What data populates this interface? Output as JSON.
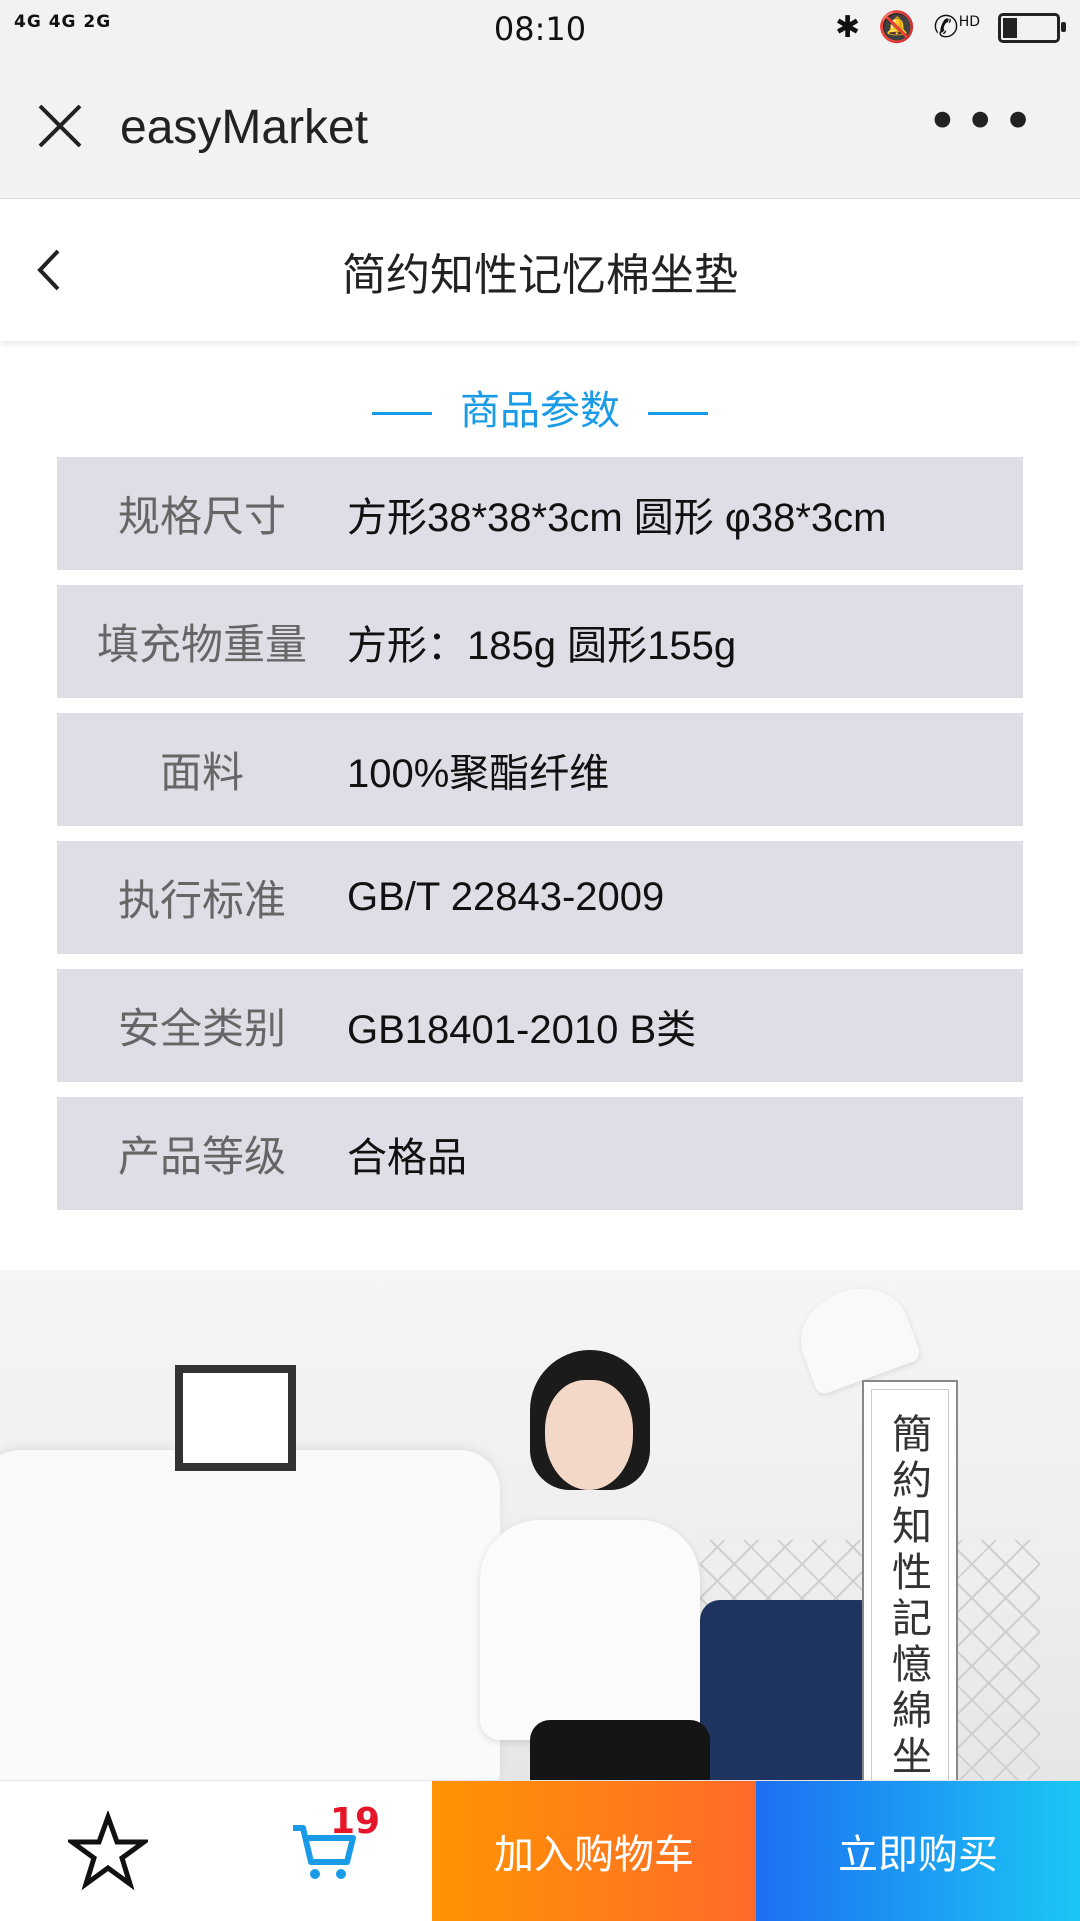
{
  "status_bar": {
    "network": "4G 4G 2G",
    "time": "08:10",
    "icons": [
      "bluetooth-icon",
      "bell-muted-icon",
      "hd-call-icon",
      "battery-icon"
    ],
    "call_label": "HD",
    "battery_level": 0.25
  },
  "appbar": {
    "title": "easyMarket",
    "more_label": "•••"
  },
  "pagenav": {
    "title": "简约知性记忆棉坐垫"
  },
  "section": {
    "title": "商品参数"
  },
  "params": [
    {
      "label": "规格尺寸",
      "value": "方形38*38*3cm 圆形 φ38*3cm"
    },
    {
      "label": "填充物重量",
      "value": "方形：185g 圆形155g"
    },
    {
      "label": "面料",
      "value": "100%聚酯纤维"
    },
    {
      "label": "执行标准",
      "value": "GB/T 22843-2009"
    },
    {
      "label": "安全类别",
      "value": "GB18401-2010 B类"
    },
    {
      "label": "产品等级",
      "value": "合格品"
    }
  ],
  "photo": {
    "vertical_label": "簡約知性記憶綿坐"
  },
  "bottombar": {
    "cart_count": "19",
    "add_to_cart": "加入购物车",
    "buy_now": "立即购买"
  },
  "colors": {
    "accent": "#1a9be8",
    "orange": "#ff8a0a",
    "blue": "#1d6ff2",
    "badge": "#e5162a"
  }
}
